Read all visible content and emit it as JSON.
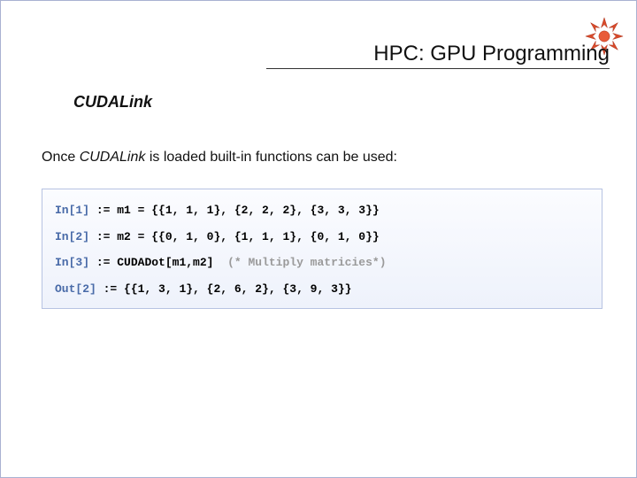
{
  "header": {
    "title": "HPC: GPU Programming"
  },
  "subtitle": "CUDALink",
  "body": {
    "prefix": "Once ",
    "ital": "CUDALink",
    "suffix": " is loaded built-in functions can be used:"
  },
  "code": {
    "l1": {
      "label": "In[1]",
      "op": " := ",
      "rest": "m1 = {{1, 1, 1}, {2, 2, 2}, {3, 3, 3}}"
    },
    "l2": {
      "label": "In[2]",
      "op": " := ",
      "rest": "m2 = {{0, 1, 0}, {1, 1, 1}, {0, 1, 0}}"
    },
    "l3": {
      "label": "In[3]",
      "op": " := ",
      "call": "CUDADot[m1,m2]",
      "sp": "  ",
      "comment": "(* Multiply matricies*)"
    },
    "l4": {
      "label": "Out[2]",
      "op": " := ",
      "rest": "{{1, 3, 1}, {2, 6, 2}, {3, 9, 3}}"
    }
  }
}
